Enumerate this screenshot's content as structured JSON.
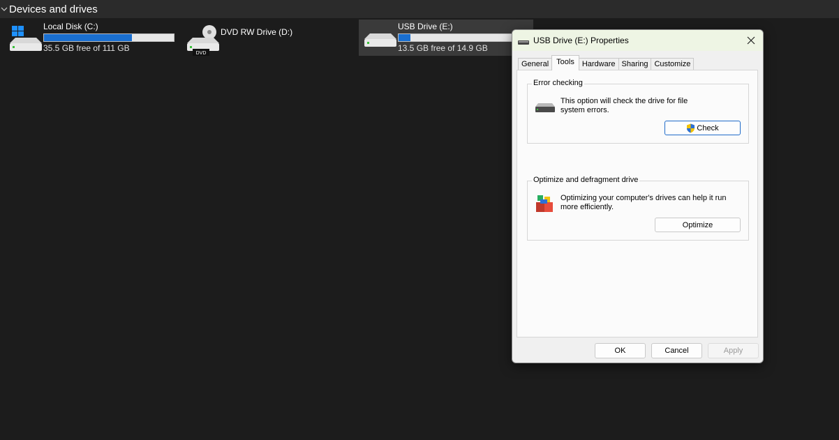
{
  "section": {
    "title": "Devices and drives"
  },
  "drives": [
    {
      "name": "Local Disk (C:)",
      "free_text": "35.5 GB free of 111 GB",
      "used_fraction": 0.68
    },
    {
      "name": "DVD RW Drive (D:)",
      "badge": "DVD"
    },
    {
      "name": "USB Drive (E:)",
      "free_text": "13.5 GB free of 14.9 GB",
      "used_fraction": 0.09
    }
  ],
  "dialog": {
    "title": "USB Drive (E:) Properties",
    "tabs": [
      "General",
      "Tools",
      "Hardware",
      "Sharing",
      "Customize"
    ],
    "active_tab": "Tools",
    "error_checking": {
      "title": "Error checking",
      "text_line1": "This option will check the drive for file",
      "text_line2": "system errors.",
      "button": "Check"
    },
    "optimize": {
      "title": "Optimize and defragment drive",
      "text_line1": "Optimizing your computer's drives can help it run",
      "text_line2": "more efficiently.",
      "button": "Optimize"
    },
    "footer": {
      "ok": "OK",
      "cancel": "Cancel",
      "apply": "Apply"
    }
  },
  "colors": {
    "accent": "#1a6fd0",
    "background": "#1c1c1c",
    "selected": "#3a3a3a"
  }
}
